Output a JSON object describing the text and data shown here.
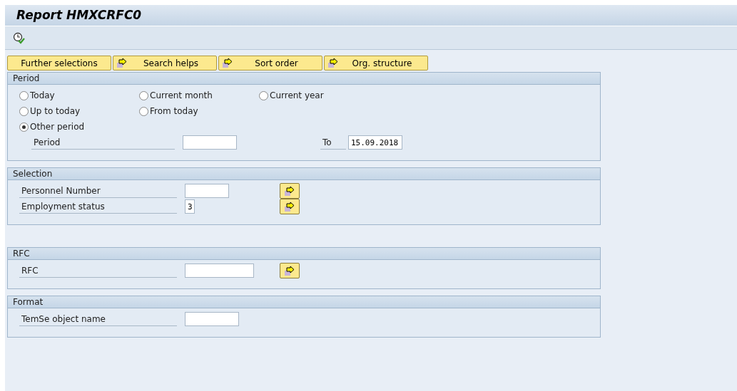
{
  "window": {
    "title": "Report HMXCRFC0"
  },
  "tabs": [
    {
      "label": "Further selections",
      "has_icon": false
    },
    {
      "label": "Search helps",
      "has_icon": true
    },
    {
      "label": "Sort order",
      "has_icon": true
    },
    {
      "label": "Org. structure",
      "has_icon": true
    }
  ],
  "groups": [
    {
      "title": "Period",
      "radio_rows": [
        [
          {
            "label": "Today",
            "selected": false
          },
          {
            "label": "Current month",
            "selected": false
          },
          {
            "label": "Current year",
            "selected": false
          }
        ],
        [
          {
            "label": "Up to today",
            "selected": false
          },
          {
            "label": "From today",
            "selected": false
          }
        ],
        [
          {
            "label": "Other period",
            "selected": true
          }
        ]
      ],
      "fields": [
        {
          "kind": "range",
          "label": "Period",
          "to_label": "To",
          "to_value": "15.09.2018"
        }
      ]
    },
    {
      "title": "Selection",
      "fields": [
        {
          "kind": "select",
          "label": "Personnel Number",
          "multiple": true
        },
        {
          "kind": "select",
          "label": "Employment status",
          "value": "3",
          "multiple": true
        }
      ]
    },
    {
      "title": "RFC",
      "fields": [
        {
          "kind": "select",
          "label": "RFC",
          "multiple": true
        }
      ]
    },
    {
      "title": "Format",
      "fields": [
        {
          "kind": "select",
          "label": "TemSe object name",
          "multiple": false
        }
      ]
    }
  ]
}
